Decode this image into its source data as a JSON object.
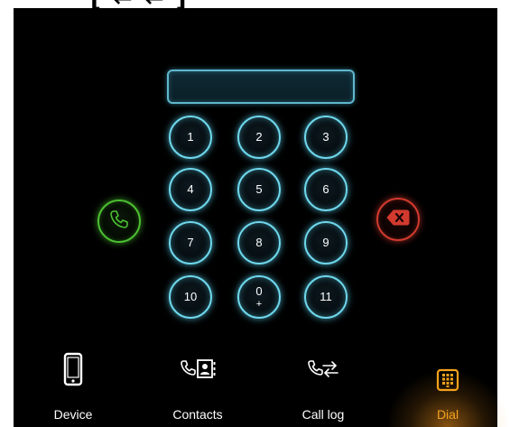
{
  "header_fragment": "[ ← ← ]",
  "display": {
    "value": ""
  },
  "keypad": {
    "keys": [
      {
        "main": "1",
        "sub": ""
      },
      {
        "main": "2",
        "sub": ""
      },
      {
        "main": "3",
        "sub": ""
      },
      {
        "main": "4",
        "sub": ""
      },
      {
        "main": "5",
        "sub": ""
      },
      {
        "main": "6",
        "sub": ""
      },
      {
        "main": "7",
        "sub": ""
      },
      {
        "main": "8",
        "sub": ""
      },
      {
        "main": "9",
        "sub": ""
      },
      {
        "main": "10",
        "sub": ""
      },
      {
        "main": "0",
        "sub": "+"
      },
      {
        "main": "11",
        "sub": ""
      }
    ]
  },
  "actions": {
    "call_icon": "phone-handset-icon",
    "delete_icon": "backspace-icon",
    "colors": {
      "call": "#4bbf32",
      "delete": "#d23a2e",
      "key_glow": "#6fd8ec"
    }
  },
  "nav": {
    "items": [
      {
        "label": "Device",
        "icon": "mobile-device-icon",
        "active": false
      },
      {
        "label": "Contacts",
        "icon": "contacts-icon",
        "active": false
      },
      {
        "label": "Call log",
        "icon": "call-log-icon",
        "active": false
      },
      {
        "label": "Dial",
        "icon": "dialpad-icon",
        "active": true
      }
    ],
    "active_color": "#f6a21c"
  }
}
